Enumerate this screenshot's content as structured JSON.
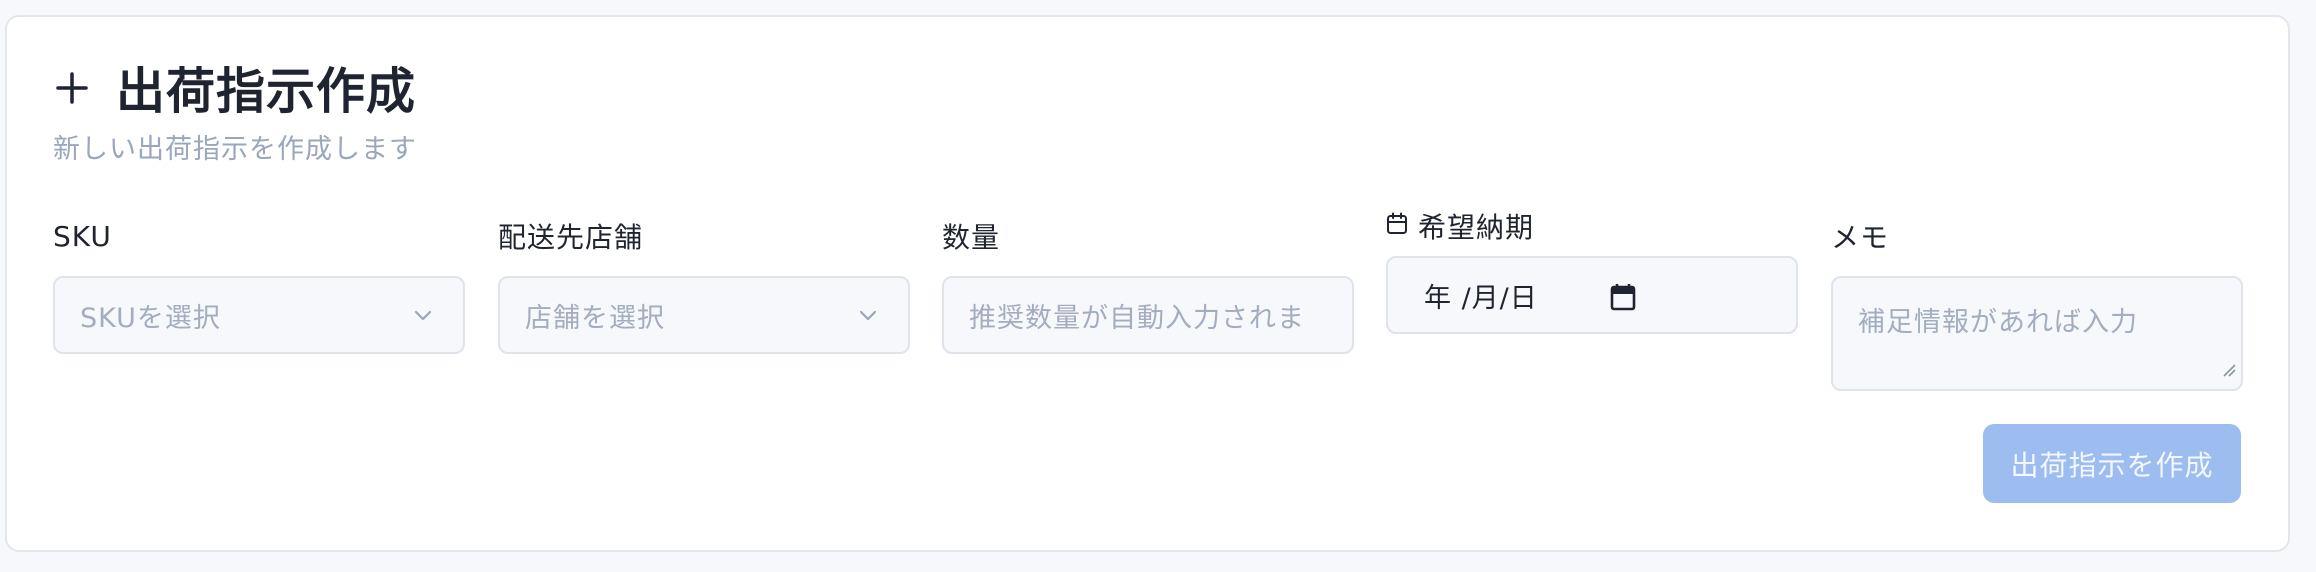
{
  "header": {
    "icon": "plus-icon",
    "title": "出荷指示作成",
    "subtitle": "新しい出荷指示を作成します"
  },
  "form": {
    "sku": {
      "label": "SKU",
      "placeholder": "SKUを選択"
    },
    "store": {
      "label": "配送先店舗",
      "placeholder": "店舗を選択"
    },
    "quantity": {
      "label": "数量",
      "placeholder": "推奨数量が自動入力されま"
    },
    "due_date": {
      "label": "希望納期",
      "icon": "calendar-icon",
      "value": "年 /月/日"
    },
    "memo": {
      "label": "メモ",
      "placeholder": "補足情報があれば入力"
    }
  },
  "actions": {
    "submit_label": "出荷指示を作成"
  },
  "colors": {
    "primary_disabled": "#9dbcf0",
    "muted_text": "#9aa6bb",
    "input_bg": "#f7f8fb",
    "border": "#dfe3ea"
  }
}
